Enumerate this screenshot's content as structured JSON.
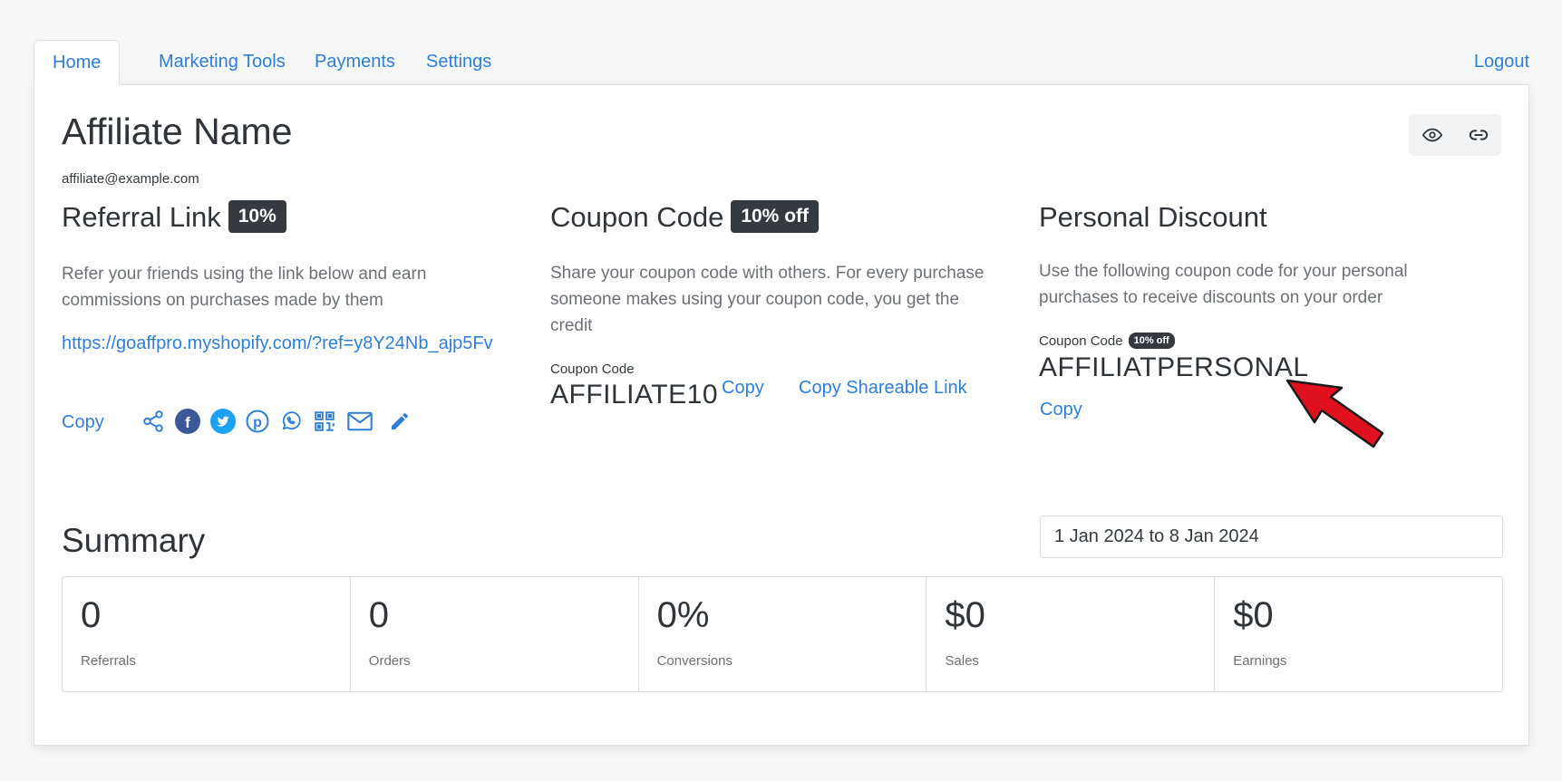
{
  "nav": {
    "tabs": [
      "Home",
      "Marketing Tools",
      "Payments",
      "Settings"
    ],
    "logout": "Logout"
  },
  "profile": {
    "name": "Affiliate Name",
    "email": "affiliate@example.com"
  },
  "header_icons": [
    "eye-icon",
    "link-icon"
  ],
  "referral": {
    "title": "Referral Link",
    "badge": "10%",
    "description": "Refer your friends using the link below and earn commissions on purchases made by them",
    "url": "https://goaffpro.myshopify.com/?ref=y8Y24Nb_ajp5Fv",
    "copy_label": "Copy",
    "share_icons": [
      "share-icon",
      "facebook-icon",
      "twitter-icon",
      "pinterest-icon",
      "whatsapp-icon",
      "qr-code-icon",
      "email-icon",
      "edit-icon"
    ]
  },
  "coupon": {
    "title": "Coupon Code",
    "badge": "10% off",
    "description": "Share your coupon code with others. For every purchase someone makes using your coupon code, you get the credit",
    "code_label": "Coupon Code",
    "code": "AFFILIATE10",
    "copy_label": "Copy",
    "copy_link_label": "Copy Shareable Link"
  },
  "personal": {
    "title": "Personal Discount",
    "description": "Use the following coupon code for your personal purchases to receive discounts on your order",
    "code_label": "Coupon Code",
    "badge": "10% off",
    "code": "AFFILIATPERSONAL",
    "copy_label": "Copy"
  },
  "summary": {
    "title": "Summary",
    "date_range": "1 Jan 2024 to 8 Jan 2024",
    "stats": [
      {
        "value": "0",
        "label": "Referrals"
      },
      {
        "value": "0",
        "label": "Orders"
      },
      {
        "value": "0%",
        "label": "Conversions"
      },
      {
        "value": "$0",
        "label": "Sales"
      },
      {
        "value": "$0",
        "label": "Earnings"
      }
    ]
  },
  "colors": {
    "link": "#2f7ed8",
    "badge": "#343a40",
    "facebook": "#3b5998",
    "twitter": "#1da1f2",
    "arrow": "#e0101e"
  }
}
